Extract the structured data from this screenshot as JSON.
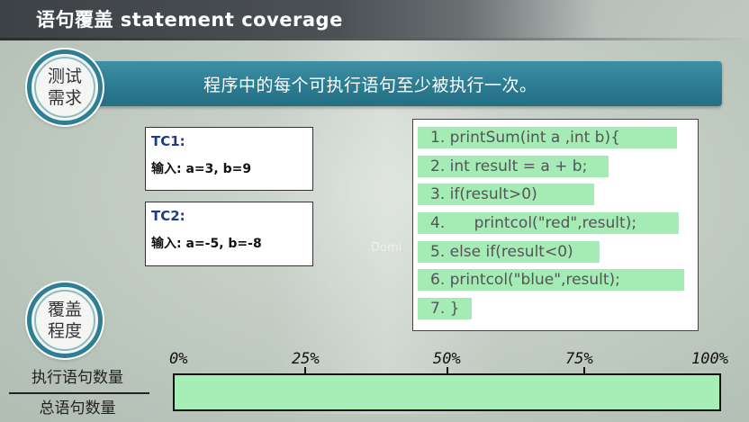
{
  "header": {
    "title": "语句覆盖 statement coverage"
  },
  "requirement": {
    "badge": [
      "测试",
      "需求"
    ],
    "text": "程序中的每个可执行语句至少被执行一次。"
  },
  "test_cases": [
    {
      "label": "TC1:",
      "input": "输入: a=3, b=9"
    },
    {
      "label": "TC2:",
      "input": "输入: a=-5, b=-8"
    }
  ],
  "code": {
    "lines": [
      "1. printSum(int a ,int b){",
      "2. int result = a + b;",
      "3. if(result>0)",
      "4.      printcol(\"red\",result);",
      "5. else if(result<0)",
      "6. printcol(\"blue\",result);",
      "7. }"
    ],
    "highlight_color": "#a5ebb6"
  },
  "coverage": {
    "badge": [
      "覆盖",
      "程度"
    ],
    "fraction_numerator": "执行语句数量",
    "fraction_denominator": "总语句数量",
    "scale_labels": [
      "0%",
      "25%",
      "50%",
      "75%",
      "100%"
    ],
    "fill_fraction": 1.0,
    "fill_color": "#a6edb7"
  },
  "watermark": "Domi"
}
